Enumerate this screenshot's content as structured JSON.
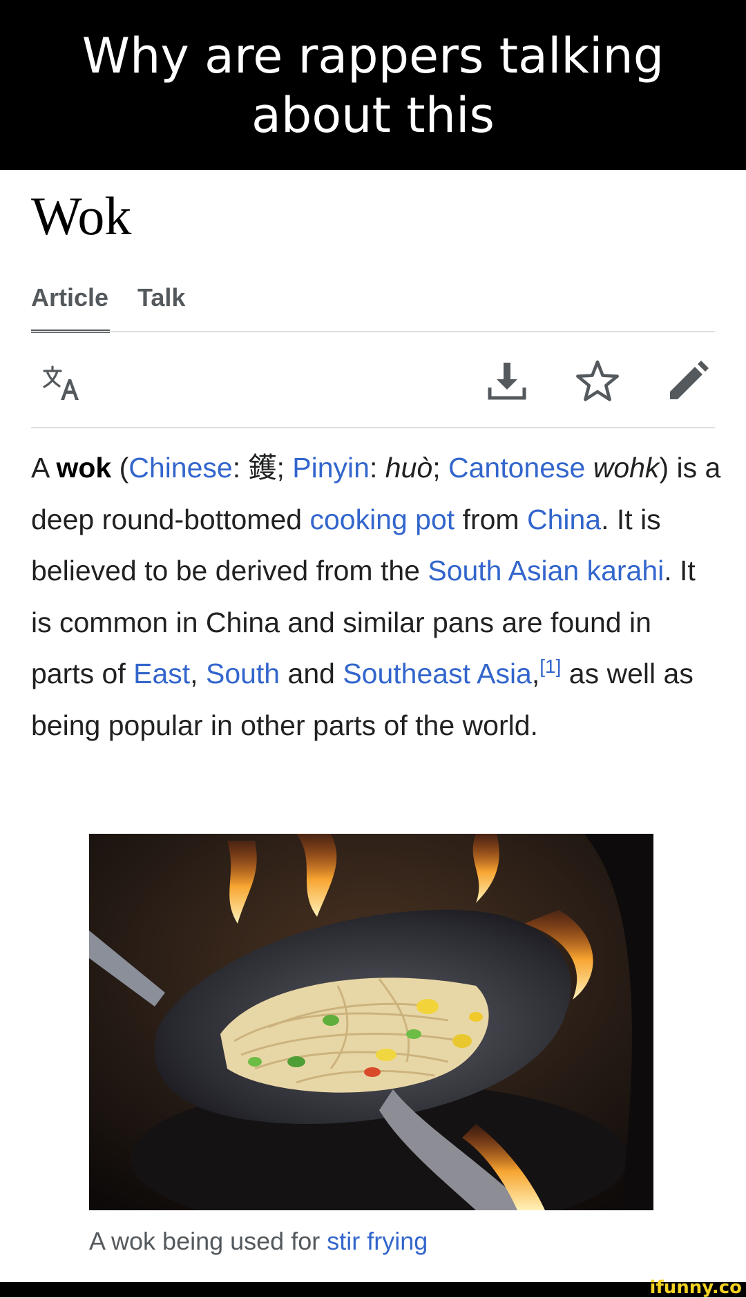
{
  "meme": {
    "caption": "Why are rappers talking about this"
  },
  "article": {
    "title": "Wok",
    "tabs": [
      {
        "label": "Article",
        "selected": true
      },
      {
        "label": "Talk",
        "selected": false
      }
    ],
    "toolbar": {
      "language_icon": "translate-icon",
      "download_icon": "download-icon",
      "watch_icon": "star-icon",
      "edit_icon": "pencil-icon"
    },
    "lead": {
      "p01": "A ",
      "p02": "wok",
      "p03": " (",
      "p04": "Chinese",
      "p05": ": 鑊; ",
      "p06": "Pinyin",
      "p07": ": ",
      "p08": "huò",
      "p09": "; ",
      "p10": "Cantonese",
      "p11": " ",
      "p12": "wohk",
      "p13": ") is a deep round-bottomed ",
      "p14": "cooking pot",
      "p15": " from ",
      "p16": "China",
      "p17": ". It is believed to be derived from the ",
      "p18": "South Asian karahi",
      "p19": ". It is common in China and similar pans are found in parts of ",
      "p20": "East",
      "p21": ", ",
      "p22": "South",
      "p23": " and ",
      "p24": "Southeast Asia",
      "p25": ",",
      "p26": "[1]",
      "p27": " as well as being popular in other parts of the world."
    },
    "figure": {
      "caption_prefix": "A wok being used for ",
      "caption_link": "stir frying"
    }
  },
  "watermark": "ifunny.co",
  "colors": {
    "link": "#3366cc",
    "text": "#202122",
    "muted": "#54595d",
    "caption_bar": "#000000",
    "watermark": "#f3d222"
  }
}
